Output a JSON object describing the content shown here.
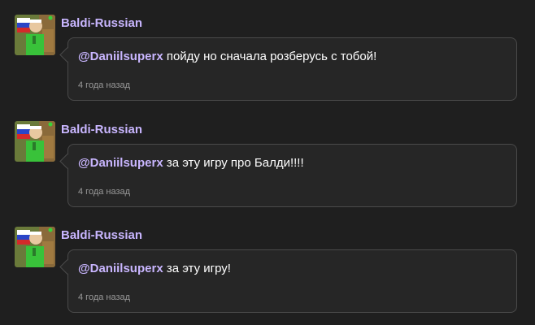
{
  "colors": {
    "background": "#1f1f1f",
    "bubble": "#262626",
    "bubble_border": "#4a4a4a",
    "username": "#c9b6ff",
    "text": "#ffffff",
    "timestamp": "#9a9a9a"
  },
  "comments": [
    {
      "author": "Baldi-Russian",
      "avatar_icon": "baldi-russian-flag-avatar",
      "mention": "@Daniilsuperx",
      "text": " пойду но сначала розберусь с тобой!",
      "time": "4 года назад"
    },
    {
      "author": "Baldi-Russian",
      "avatar_icon": "baldi-russian-flag-avatar",
      "mention": "@Daniilsuperx",
      "text": " за эту игру про Балди!!!!",
      "time": "4 года назад"
    },
    {
      "author": "Baldi-Russian",
      "avatar_icon": "baldi-russian-flag-avatar",
      "mention": "@Daniilsuperx",
      "text": " за эту игру!",
      "time": "4 года назад"
    }
  ]
}
